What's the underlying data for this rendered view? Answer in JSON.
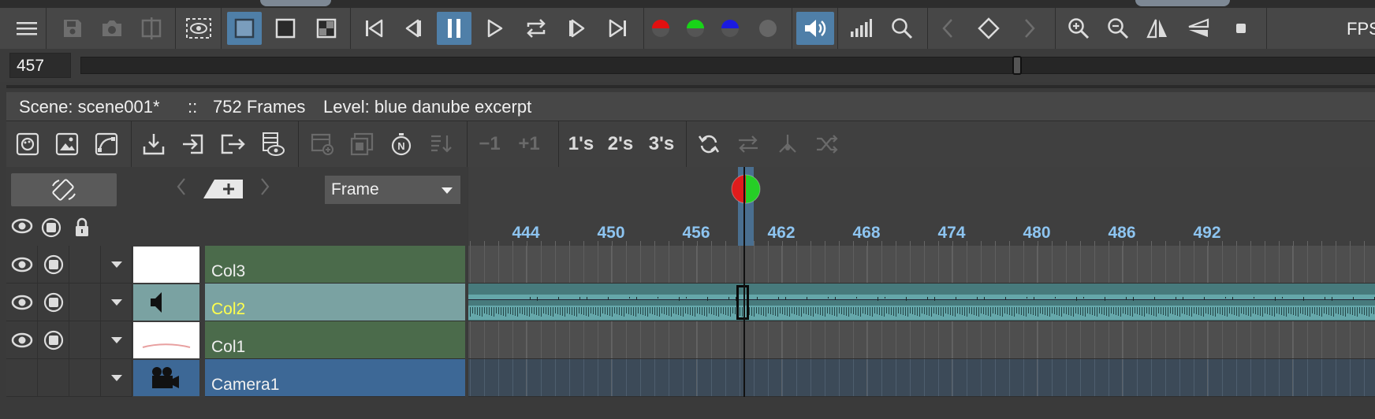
{
  "toolbar": {
    "fps_label": "FPS",
    "colors": {
      "active": "#4f7fa8",
      "icon": "#dcdcdc",
      "dim": "#6e6e6e"
    }
  },
  "frame_field": {
    "value": "457"
  },
  "info": {
    "scene": "Scene: scene001*",
    "separator": "::",
    "frames": "752 Frames",
    "level": "Level: blue danube excerpt"
  },
  "toolbar2": {
    "minus_one": "−1",
    "plus_one": "+1",
    "ones": "1's",
    "twos": "2's",
    "threes": "3's"
  },
  "header": {
    "frame_select": "Frame"
  },
  "ruler": {
    "labels": [
      "444",
      "450",
      "456",
      "462",
      "468",
      "474",
      "480",
      "486",
      "492"
    ],
    "current_frame": 457
  },
  "columns": [
    {
      "name": "Col3",
      "type": "level",
      "name_color": "#f0f0f0",
      "bg": "#4b6b4b"
    },
    {
      "name": "Col2",
      "type": "sound",
      "name_color": "#ffff4d",
      "bg": "#7aa2a2"
    },
    {
      "name": "Col1",
      "type": "level",
      "name_color": "#f0f0f0",
      "bg": "#4b6b4b"
    },
    {
      "name": "Camera1",
      "type": "camera",
      "name_color": "#f0f0f0",
      "bg": "#3d6896"
    }
  ]
}
